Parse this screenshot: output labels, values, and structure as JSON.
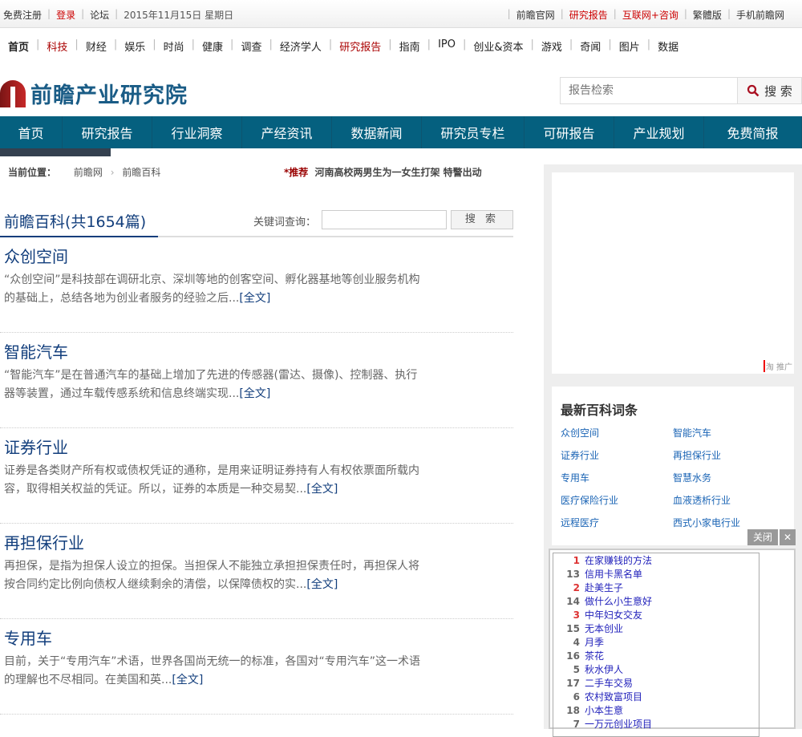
{
  "topbar": {
    "left": [
      "免费注册",
      "登录",
      "论坛",
      "2015年11月15日 星期日"
    ],
    "right": [
      "前瞻官网",
      "研究报告",
      "互联网+咨询",
      "繁體版",
      "手机前瞻网"
    ]
  },
  "channels": [
    "首页",
    "科技",
    "财经",
    "娱乐",
    "时尚",
    "健康",
    "调查",
    "经济学人",
    "研究报告",
    "指南",
    "IPO",
    "创业&资本",
    "游戏",
    "奇闻",
    "图片",
    "数据"
  ],
  "logo": {
    "text": "前瞻产业研究院"
  },
  "search": {
    "placeholder": "报告检索",
    "button": "搜 索"
  },
  "nav": [
    "首页",
    "研究报告",
    "行业洞察",
    "产经资讯",
    "数据新闻",
    "研究员专栏",
    "可研报告",
    "产业规划",
    "免费简报"
  ],
  "breadcrumb": {
    "label": "当前位置：",
    "items": [
      "前瞻网",
      "前瞻百科"
    ]
  },
  "recommend": {
    "label": "*推荐",
    "text": "河南高校两男生为一女生打架 特警出动"
  },
  "list": {
    "title": "前瞻百科(共1654篇)",
    "keyword_label": "关键词查询：",
    "keyword_value": "",
    "search_button": "搜 索",
    "more_label": "[全文]",
    "items": [
      {
        "title": "众创空间",
        "summary": "“众创空间”是科技部在调研北京、深圳等地的创客空间、孵化器基地等创业服务机构的基础上，总结各地为创业者服务的经验之后..."
      },
      {
        "title": "智能汽车",
        "summary": "“智能汽车”是在普通汽车的基础上增加了先进的传感器(雷达、摄像)、控制器、执行器等装置，通过车载传感系统和信息终端实现..."
      },
      {
        "title": "证券行业",
        "summary": "证券是各类财产所有权或债权凭证的通称，是用来证明证券持有人有权依票面所载内容，取得相关权益的凭证。所以，证券的本质是一种交易契..."
      },
      {
        "title": "再担保行业",
        "summary": "再担保，是指为担保人设立的担保。当担保人不能独立承担担保责任时，再担保人将按合同约定比例向债权人继续剩余的清偿，以保障债权的实..."
      },
      {
        "title": "专用车",
        "summary": "目前，关于“专用汽车”术语，世界各国尚无统一的标准，各国对“专用汽车”这一术语的理解也不尽相同。在美国和英..."
      }
    ]
  },
  "ad": {
    "tag": "淘 推广"
  },
  "latest": {
    "title": "最新百科词条",
    "items": [
      "众创空间",
      "智能汽车",
      "证券行业",
      "再担保行业",
      "专用车",
      "智慧水务",
      "医疗保险行业",
      "血液透析行业",
      "远程医疗",
      "西式小家电行业"
    ]
  },
  "close": {
    "label": "关闭",
    "x": "✕"
  },
  "adlist": [
    {
      "rank": "1",
      "text": "在家赚钱的方法",
      "hot": true
    },
    {
      "rank": "13",
      "text": "信用卡黑名单"
    },
    {
      "rank": "2",
      "text": "赴美生子",
      "hot": true
    },
    {
      "rank": "14",
      "text": "做什么小生意好"
    },
    {
      "rank": "3",
      "text": "中年妇女交友",
      "hot": true
    },
    {
      "rank": "15",
      "text": "无本创业"
    },
    {
      "rank": "4",
      "text": "月季"
    },
    {
      "rank": "16",
      "text": "茶花"
    },
    {
      "rank": "5",
      "text": "秋水伊人"
    },
    {
      "rank": "17",
      "text": "二手车交易"
    },
    {
      "rank": "6",
      "text": "农村致富项目"
    },
    {
      "rank": "18",
      "text": "小本生意"
    },
    {
      "rank": "7",
      "text": "一万元创业项目"
    }
  ]
}
